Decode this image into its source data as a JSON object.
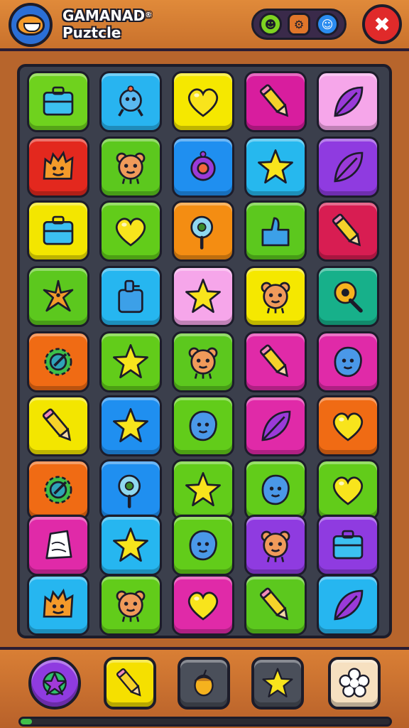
{
  "header": {
    "title_line1": "GAMANAD",
    "title_reg": "®",
    "title_line2": "Puztcle",
    "logo_icon": "smiling-face-logo-icon",
    "status_icons": [
      "green-monster-icon",
      "orange-gear-icon",
      "blue-face-icon"
    ],
    "close_icon": "close-icon",
    "close_glyph": "✖"
  },
  "board": {
    "rows": [
      [
        {
          "icon": "briefcase",
          "bg": "#6fd21e"
        },
        {
          "icon": "creature",
          "bg": "#28b4f0"
        },
        {
          "icon": "heart",
          "bg": "#f5e800"
        },
        {
          "icon": "pencil",
          "bg": "#d81d9e"
        },
        {
          "icon": "leaf",
          "bg": "#f6a6ea"
        }
      ],
      [
        {
          "icon": "monster",
          "bg": "#e3281e"
        },
        {
          "icon": "bear",
          "bg": "#5cc81e"
        },
        {
          "icon": "orb",
          "bg": "#1f8ff0"
        },
        {
          "icon": "star",
          "bg": "#26b8ee"
        },
        {
          "icon": "leaf",
          "bg": "#8f3be0"
        }
      ],
      [
        {
          "icon": "briefcase",
          "bg": "#f3e600"
        },
        {
          "icon": "heart",
          "bg": "#62cc1a"
        },
        {
          "icon": "magnifier",
          "bg": "#f48d12"
        },
        {
          "icon": "thumb",
          "bg": "#5cc81e"
        },
        {
          "icon": "pencil",
          "bg": "#d81d52"
        }
      ],
      [
        {
          "icon": "starfish",
          "bg": "#5cc81e"
        },
        {
          "icon": "bottle",
          "bg": "#26b6f0"
        },
        {
          "icon": "star",
          "bg": "#f6a6ea"
        },
        {
          "icon": "bear",
          "bg": "#f5e800"
        },
        {
          "icon": "keyhole",
          "bg": "#17b08a"
        }
      ],
      [
        {
          "icon": "gear",
          "bg": "#f06b14"
        },
        {
          "icon": "star",
          "bg": "#62cc1a"
        },
        {
          "icon": "bear",
          "bg": "#5cc81e"
        },
        {
          "icon": "pencil",
          "bg": "#e02aa8"
        },
        {
          "icon": "blob",
          "bg": "#e02aa8"
        }
      ],
      [
        {
          "icon": "pencil",
          "bg": "#f3e600"
        },
        {
          "icon": "star",
          "bg": "#1f8ff0"
        },
        {
          "icon": "blob",
          "bg": "#62cc1a"
        },
        {
          "icon": "leaf",
          "bg": "#e02aa8"
        },
        {
          "icon": "heart",
          "bg": "#f06b14"
        }
      ],
      [
        {
          "icon": "gear",
          "bg": "#f06b14"
        },
        {
          "icon": "magnifier",
          "bg": "#1f8ff0"
        },
        {
          "icon": "star",
          "bg": "#62cc1a"
        },
        {
          "icon": "blob",
          "bg": "#62cc1a"
        },
        {
          "icon": "heart",
          "bg": "#62cc1a"
        }
      ],
      [
        {
          "icon": "paper",
          "bg": "#e02aa8"
        },
        {
          "icon": "star",
          "bg": "#26b6f0"
        },
        {
          "icon": "blob",
          "bg": "#62cc1a"
        },
        {
          "icon": "bear",
          "bg": "#8f3be0"
        },
        {
          "icon": "briefcase",
          "bg": "#8f3be0"
        }
      ],
      [
        {
          "icon": "monster",
          "bg": "#26b6f0"
        },
        {
          "icon": "bear",
          "bg": "#62cc1a"
        },
        {
          "icon": "heart",
          "bg": "#e02aa8"
        },
        {
          "icon": "pencil",
          "bg": "#5cc81e"
        },
        {
          "icon": "leaf",
          "bg": "#26b6f0"
        }
      ]
    ]
  },
  "powerups": [
    {
      "name": "purple-splat-icon",
      "icon": "splat",
      "bg": "#8f3be0",
      "round": true
    },
    {
      "name": "blue-pencil-icon",
      "icon": "pencil",
      "bg": "#f5e000",
      "round": false
    },
    {
      "name": "acorn-icon",
      "icon": "acorn",
      "bg": "#4a4f5a",
      "round": false
    },
    {
      "name": "star-icon",
      "icon": "star",
      "bg": "#4a4f5a",
      "round": false
    },
    {
      "name": "flower-icon",
      "icon": "flower",
      "bg": "#f6e0c0",
      "round": false
    }
  ],
  "progress": {
    "fraction": 0.03,
    "color": "#3fbf4a"
  }
}
